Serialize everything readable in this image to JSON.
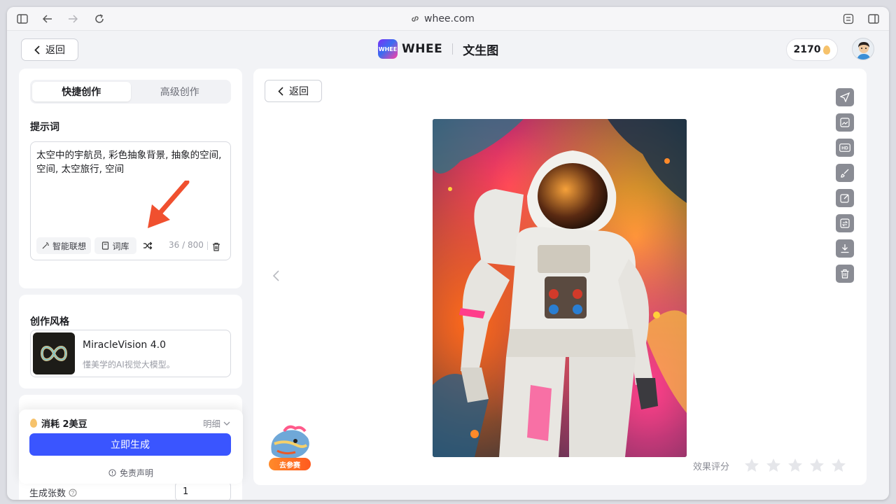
{
  "browser": {
    "url": "whee.com"
  },
  "header": {
    "back_label": "返回",
    "brand_logo_text": "WHEE",
    "brand_name": "WHEE",
    "page_title": "文生图",
    "credits": "2170"
  },
  "left": {
    "tabs": [
      {
        "label": "快捷创作",
        "active": true
      },
      {
        "label": "高级创作",
        "active": false
      }
    ],
    "prompt": {
      "title": "提示词",
      "text": "太空中的宇航员, 彩色抽象背景, 抽象的空间, 空间, 太空旅行, 空间",
      "smart_label": "智能联想",
      "lexicon_label": "词库",
      "counter": "36 / 800"
    },
    "style": {
      "title": "创作风格",
      "name": "MiracleVision 4.0",
      "desc": "懂美学的AI视觉大模型。"
    },
    "generate": {
      "cost_label": "消耗 2美豆",
      "detail_label": "明细",
      "button_label": "立即生成",
      "disclaimer": "免责声明",
      "count_label": "生成张数",
      "count_value": "1"
    }
  },
  "main": {
    "back_label": "返回",
    "rating_label": "效果评分",
    "promo_label": "去参赛",
    "tools": [
      "send-icon",
      "image-edit-icon",
      "hd-icon",
      "brush-icon",
      "edit-box-icon",
      "image-swap-icon",
      "download-icon",
      "trash-icon"
    ]
  },
  "colors": {
    "primary": "#3a55ff",
    "accent_arrow": "#f0502f"
  }
}
